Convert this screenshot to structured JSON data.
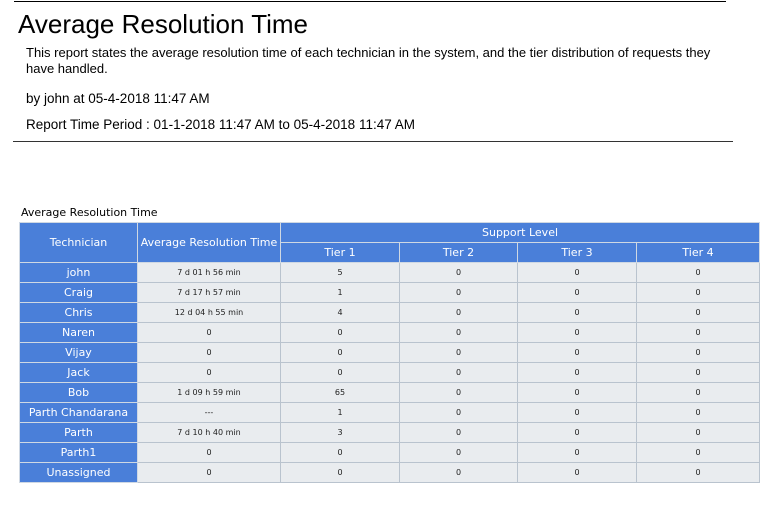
{
  "header": {
    "title": "Average Resolution Time",
    "description": "This report states the average resolution time of each technician in the system, and the tier distribution of requests they have handled.",
    "byline": "by john at 05-4-2018 11:47 AM",
    "period": "Report Time Period : 01-1-2018 11:47 AM to 05-4-2018 11:47 AM"
  },
  "table": {
    "caption": "Average Resolution Time",
    "headers": {
      "technician": "Technician",
      "avg_time": "Average Resolution Time",
      "support_level": "Support Level",
      "tiers": [
        "Tier 1",
        "Tier 2",
        "Tier 3",
        "Tier 4"
      ]
    },
    "rows": [
      {
        "technician": "john",
        "avg_time": "7 d 01 h 56 min",
        "tiers": [
          "5",
          "0",
          "0",
          "0"
        ]
      },
      {
        "technician": "Craig",
        "avg_time": "7 d 17 h 57 min",
        "tiers": [
          "1",
          "0",
          "0",
          "0"
        ]
      },
      {
        "technician": "Chris",
        "avg_time": "12 d 04 h 55 min",
        "tiers": [
          "4",
          "0",
          "0",
          "0"
        ]
      },
      {
        "technician": "Naren",
        "avg_time": "0",
        "tiers": [
          "0",
          "0",
          "0",
          "0"
        ]
      },
      {
        "technician": "Vijay",
        "avg_time": "0",
        "tiers": [
          "0",
          "0",
          "0",
          "0"
        ]
      },
      {
        "technician": "Jack",
        "avg_time": "0",
        "tiers": [
          "0",
          "0",
          "0",
          "0"
        ]
      },
      {
        "technician": "Bob",
        "avg_time": "1 d 09 h 59 min",
        "tiers": [
          "65",
          "0",
          "0",
          "0"
        ]
      },
      {
        "technician": "Parth Chandarana",
        "avg_time": "---",
        "tiers": [
          "1",
          "0",
          "0",
          "0"
        ]
      },
      {
        "technician": "Parth",
        "avg_time": "7 d 10 h 40 min",
        "tiers": [
          "3",
          "0",
          "0",
          "0"
        ]
      },
      {
        "technician": "Parth1",
        "avg_time": "0",
        "tiers": [
          "0",
          "0",
          "0",
          "0"
        ]
      },
      {
        "technician": "Unassigned",
        "avg_time": "0",
        "tiers": [
          "0",
          "0",
          "0",
          "0"
        ]
      }
    ]
  },
  "colors": {
    "header_bg": "#4a7fd9",
    "cell_bg": "#e9ecef"
  }
}
